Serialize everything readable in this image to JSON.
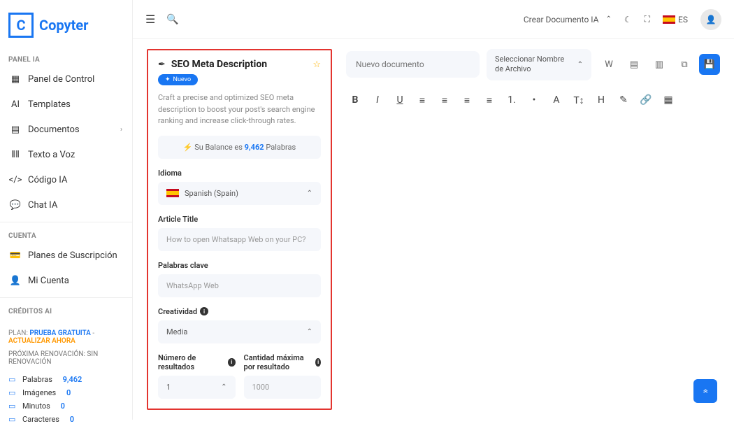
{
  "brand": {
    "initial": "C",
    "name": "Copyter"
  },
  "topbar": {
    "create_doc": "Crear Documento IA",
    "lang_code": "ES"
  },
  "sidebar": {
    "section_panel": "PANEL IA",
    "section_account": "CUENTA",
    "section_credits": "CRÉDITOS AI",
    "items_panel": [
      {
        "label": "Panel de Control",
        "icon": "▦"
      },
      {
        "label": "Templates",
        "icon": "AI"
      },
      {
        "label": "Documentos",
        "icon": "▤",
        "chevron": true
      },
      {
        "label": "Texto a Voz",
        "icon": "⦀⦀"
      },
      {
        "label": "Código IA",
        "icon": "</>"
      },
      {
        "label": "Chat IA",
        "icon": "💬"
      }
    ],
    "items_account": [
      {
        "label": "Planes de Suscripción",
        "icon": "💳"
      },
      {
        "label": "Mi Cuenta",
        "icon": "👤"
      }
    ],
    "plan_prefix": "PLAN: ",
    "plan_name": "PRUEBA GRATUITA",
    "plan_sep": " - ",
    "plan_action": "ACTUALIZAR AHORA",
    "renewal": "PRÓXIMA RENOVACIÓN: SIN RENOVACIÓN",
    "stats": [
      {
        "label": "Palabras",
        "value": "9,462",
        "icon": "▭"
      },
      {
        "label": "Imágenes",
        "value": "0",
        "icon": "▭"
      },
      {
        "label": "Minutos",
        "value": "0",
        "icon": "▭"
      },
      {
        "label": "Caracteres",
        "value": "0",
        "icon": "▭"
      }
    ]
  },
  "form": {
    "title": "SEO Meta Description",
    "badge": "Nuevo",
    "description": "Craft a precise and optimized SEO meta description to boost your post's search engine ranking and increase click-through rates.",
    "balance_prefix": "Su Balance es ",
    "balance_value": "9,462",
    "balance_suffix": " Palabras",
    "labels": {
      "language": "Idioma",
      "article_title": "Article Title",
      "keywords": "Palabras clave",
      "creativity": "Creatividad",
      "num_results": "Número de resultados",
      "max_per_result": "Cantidad máxima por resultado"
    },
    "values": {
      "language": "Spanish (Spain)",
      "article_title": "How to open Whatsapp Web on your PC?",
      "keywords": "WhatsApp Web",
      "creativity": "Media",
      "num_results": "1",
      "max_per_result": "1000"
    }
  },
  "editor": {
    "doc_placeholder": "Nuevo documento",
    "file_select": "Seleccionar Nombre de Archivo"
  }
}
